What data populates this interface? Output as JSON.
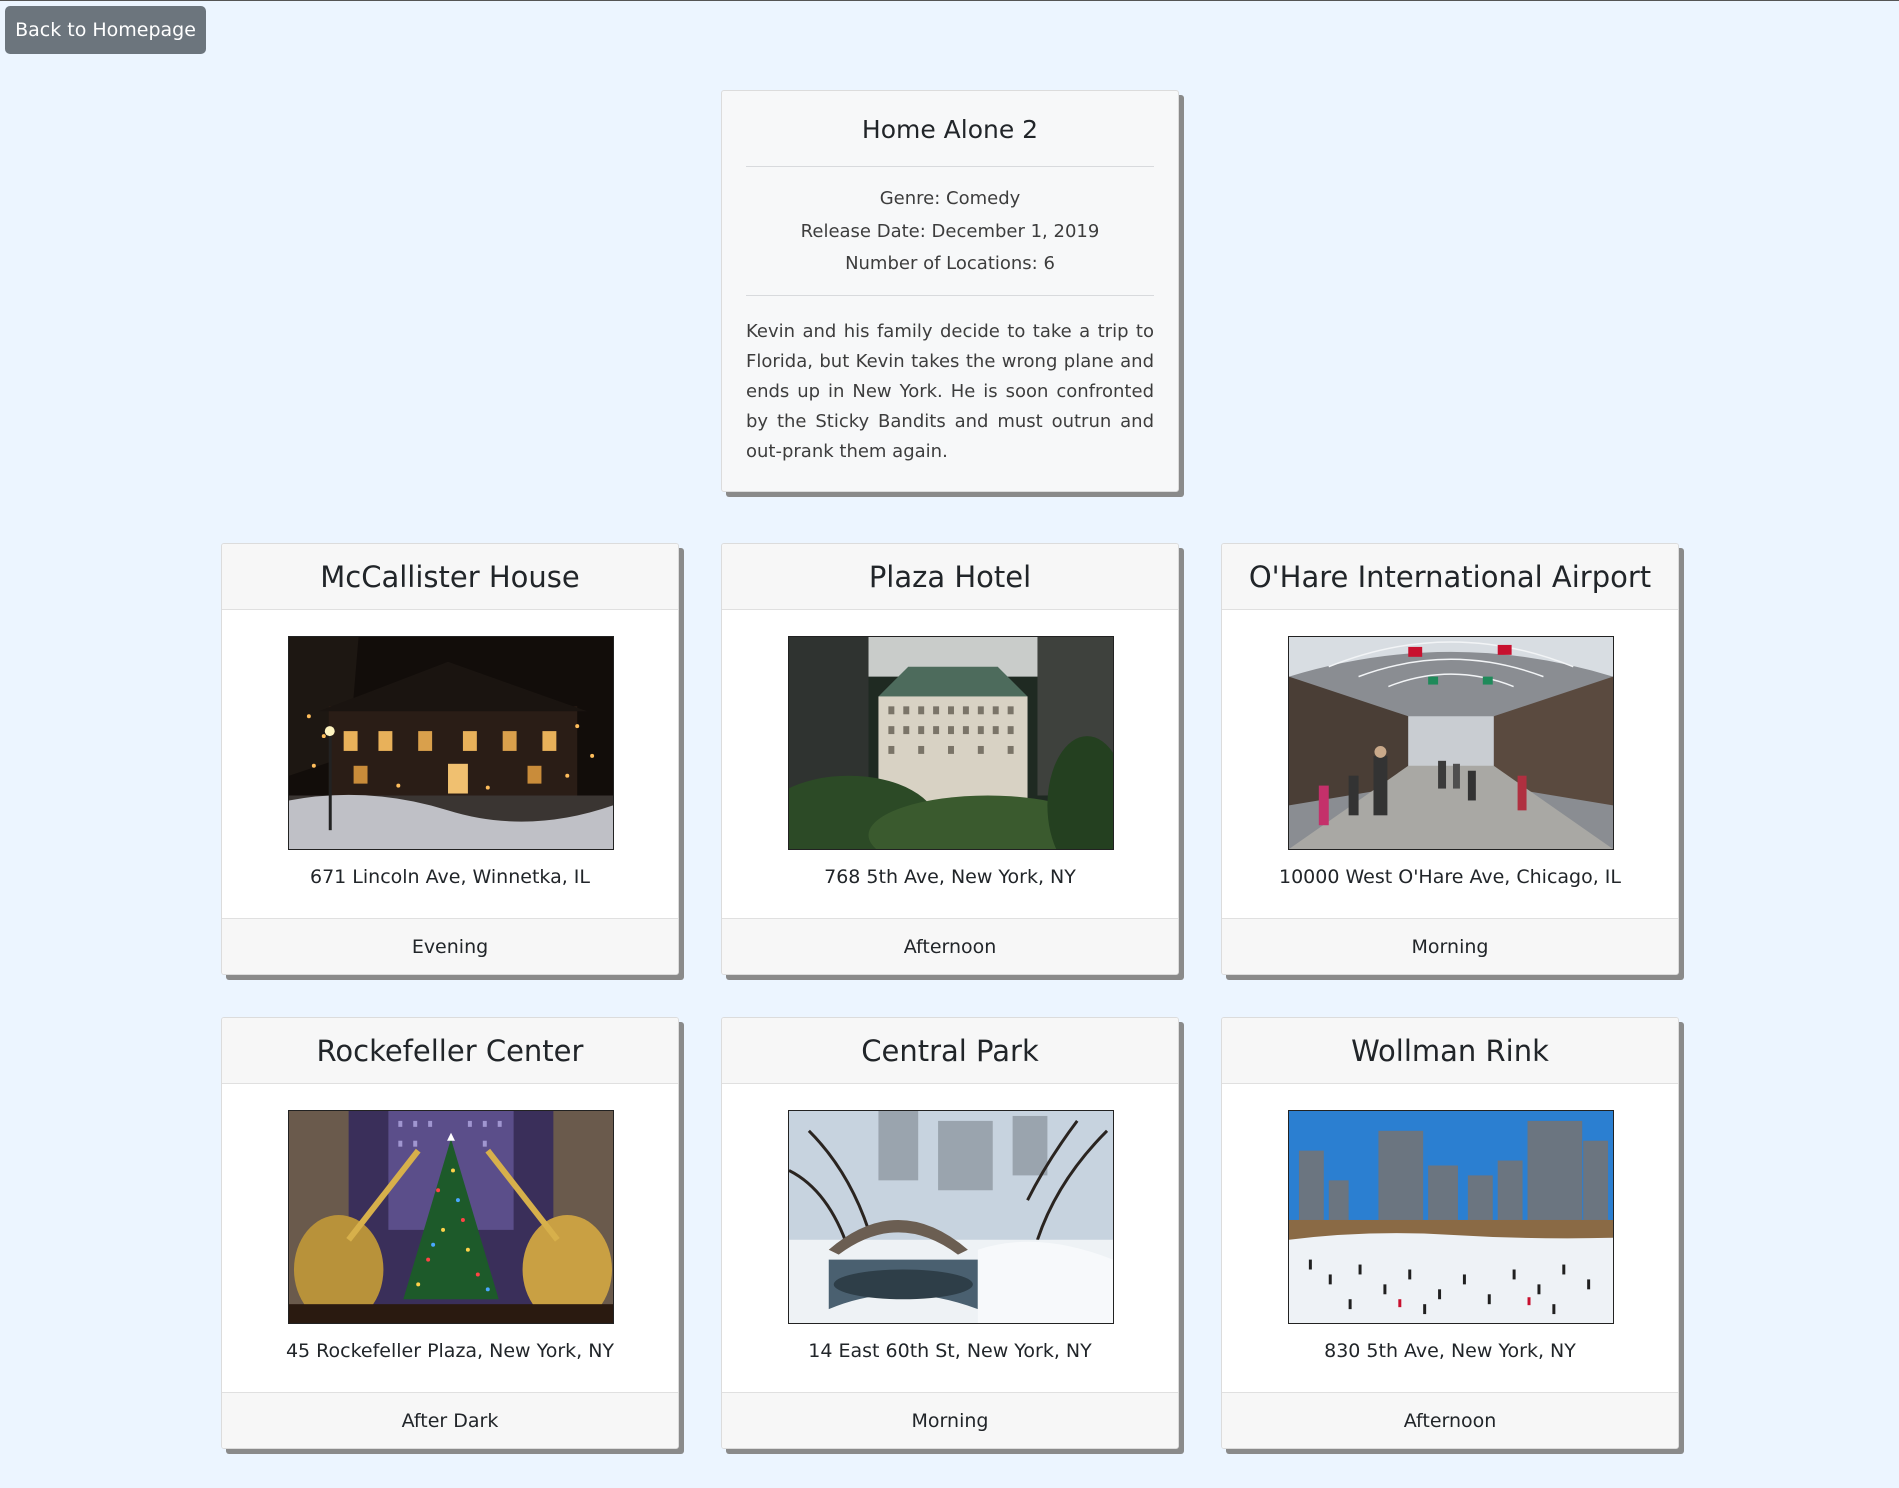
{
  "nav": {
    "back_label": "Back to Homepage"
  },
  "movie": {
    "title": "Home Alone 2",
    "genre": "Genre: Comedy",
    "release_date": "Release Date: December 1, 2019",
    "num_locations": "Number of Locations: 6",
    "description": "Kevin and his family decide to take a trip to Florida, but Kevin takes the wrong plane and ends up in New York. He is soon confronted by the Sticky Bandits and must outrun and out-prank them again."
  },
  "locations": [
    {
      "name": "McCallister House",
      "address": "671 Lincoln Ave, Winnetka, IL",
      "time": "Evening",
      "image": "house-at-night-with-christmas-lights"
    },
    {
      "name": "Plaza Hotel",
      "address": "768 5th Ave, New York, NY",
      "time": "Afternoon",
      "image": "plaza-hotel-building"
    },
    {
      "name": "O'Hare International Airport",
      "address": "10000 West O'Hare Ave, Chicago, IL",
      "time": "Morning",
      "image": "airport-terminal-concourse"
    },
    {
      "name": "Rockefeller Center",
      "address": "45 Rockefeller Plaza, New York, NY",
      "time": "After Dark",
      "image": "christmas-tree-with-golden-angels"
    },
    {
      "name": "Central Park",
      "address": "14 East 60th St, New York, NY",
      "time": "Morning",
      "image": "snowy-park-bridge"
    },
    {
      "name": "Wollman Rink",
      "address": "830 5th Ave, New York, NY",
      "time": "Afternoon",
      "image": "ice-rink-with-skyline"
    }
  ]
}
